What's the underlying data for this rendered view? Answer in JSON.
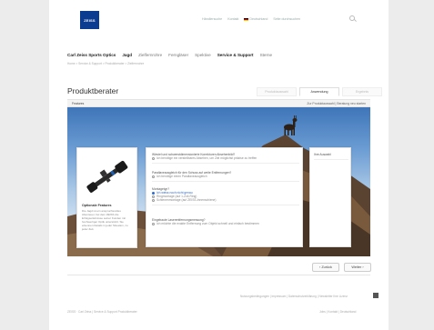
{
  "brand": {
    "logo_text": "ZEISS",
    "logo_color": "#0a3d8f"
  },
  "header": {
    "links": [
      "Händlersuche",
      "Kontakt",
      "Deutschland",
      "Seite durchsuchen"
    ]
  },
  "nav": {
    "items": [
      "Carl Zeiss Sports Optics",
      "Jagd",
      "Zielfernrohre",
      "Ferngläser",
      "Spektive",
      "Service & Support",
      "Sterne"
    ]
  },
  "breadcrumb": "Home > Service & Support > Produktberater > Zielfernrohre",
  "page": {
    "title": "Produktberater"
  },
  "tabs": [
    "Produktauswahl",
    "Anwendung",
    "Ergebnis"
  ],
  "subbar": {
    "left": "Features",
    "right": "Zur Produktauswahl | Beratung neu starten"
  },
  "left_card": {
    "title": "Optionale Features",
    "text": "Die Jagd ist ein anspruchsvolles Abenteuer, bei dem ZEISS die Erfolgserlebnisse seiner Kunden mit hochwertiger Optik unterstützt. Sie erkennen Details in jeder Situation, zu jeder Zeit."
  },
  "questions": [
    {
      "text": "Wieviel und schwerstdimensionierte Korrekturen Absehenbild?",
      "options": [
        {
          "label": "Ich benötige ein verstellbares Absehen, um Ziel möglichst präzise zu treffen",
          "selected": false
        }
      ]
    },
    {
      "text": "Parallaxeausgleich für den Schuss auf weite Entfernungen?",
      "options": [
        {
          "label": "Ich benötige einen Parallaxeausgleich",
          "selected": false
        }
      ]
    },
    {
      "text": "Montagetyp?",
      "options": [
        {
          "label": "Ich weiss noch nicht genau",
          "selected": true
        },
        {
          "label": "Ringmontage (auf 1-Zoll-Ring)",
          "selected": false
        },
        {
          "label": "Schienenmontage (auf ZEISS-Innenschiene)",
          "selected": false
        }
      ]
    },
    {
      "text": "Eingebaute Laserentfernungsmessung?",
      "options": [
        {
          "label": "Ich möchte die exakte Entfernung zum Objekt schnell und einfach bestimmen",
          "selected": false
        }
      ]
    }
  ],
  "right_card": {
    "label": "Ihre Auswahl"
  },
  "buttons": {
    "back": "‹ Zurück",
    "next": "Weiter ›"
  },
  "footer": {
    "links": "Nutzungsbedingungen | Impressum | Datenschutzerklärung | Newsletter Ihre Lizenz",
    "left": "ZEISS · Carl Zeiss | Service & Support Produktberater",
    "right": "Jobs | Kontakt | Deutschland"
  }
}
